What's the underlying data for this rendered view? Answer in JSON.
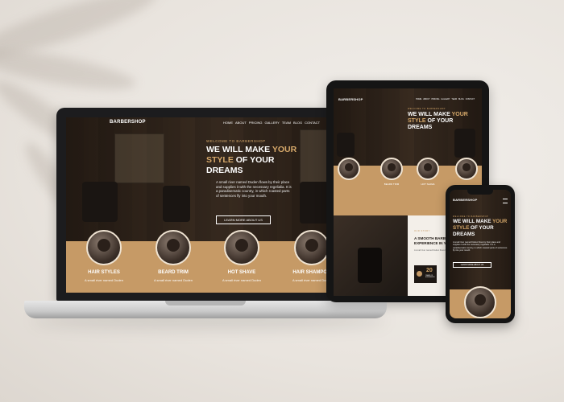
{
  "site": {
    "logo": "BARBERSHOP",
    "nav": [
      "HOME",
      "ABOUT",
      "PRICING",
      "GALLERY",
      "TEAM",
      "BLOG",
      "CONTACT"
    ],
    "kicker": "WELCOME TO BARBERSHOP",
    "headline": {
      "line1": "WE WILL MAKE YOUR",
      "line2_accent": "STYLE",
      "line2_rest": " OF YOUR",
      "line3": "DREAMS",
      "line1_a": "WE WILL MAKE ",
      "line1_b": "YOUR"
    },
    "paragraph": "A small river named Duden flows by their place and supplies it with the necessary regelialia. It is a paradisematic country, in which roasted parts of sentences fly into your mouth.",
    "cta": "LEARN MORE ABOUT US",
    "services": [
      {
        "title": "HAIR STYLES",
        "desc": "A small river named Duden"
      },
      {
        "title": "BEARD TRIM",
        "desc": "A small river named Duden"
      },
      {
        "title": "HOT SHAVE",
        "desc": "A small river named Duden"
      },
      {
        "title": "HAIR SHAMPOO",
        "desc": "A small river named Duden"
      }
    ]
  },
  "tablet": {
    "service_short": [
      "BEARD TRIM",
      "HOT SHAVE"
    ],
    "about_kicker": "OUR STORY",
    "about_title_1": "A SMOOTH BARBER",
    "about_title_2": "EXPERIENCE IN YOUR",
    "about_text": "A small river named Duden flows by their place and supplies it.",
    "years": "20",
    "years_label": "YEARS OF EXPERIENCE"
  },
  "colors": {
    "accent": "#c69a66",
    "accent_text": "#d6a86a",
    "dark": "#2a221b"
  }
}
